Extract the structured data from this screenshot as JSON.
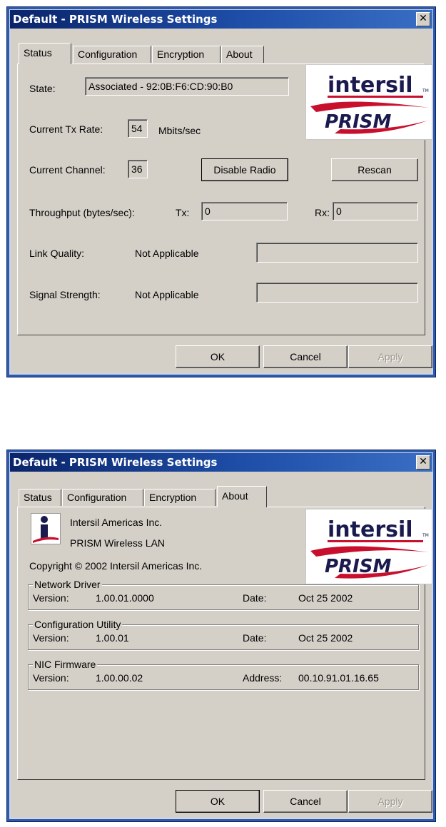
{
  "window_title": "Default - PRISM Wireless Settings",
  "close_glyph": "✕",
  "tabs": [
    "Status",
    "Configuration",
    "Encryption",
    "About"
  ],
  "buttons": {
    "ok": "OK",
    "cancel": "Cancel",
    "apply": "Apply"
  },
  "logo": {
    "intersil_text": "intersil",
    "tm": "TM",
    "prism_text": "PRISM",
    "brand_red": "#c8102e",
    "brand_navy": "#1a1a4e"
  },
  "status": {
    "state_label": "State:",
    "state_value": "Associated - 92:0B:F6:CD:90:B0",
    "tx_rate_label": "Current Tx Rate:",
    "tx_rate_value": "54",
    "tx_rate_unit": "Mbits/sec",
    "channel_label": "Current Channel:",
    "channel_value": "36",
    "disable_radio": "Disable Radio",
    "rescan": "Rescan",
    "throughput_label": "Throughput (bytes/sec):",
    "tx_label": "Tx:",
    "tx_value": "0",
    "rx_label": "Rx:",
    "rx_value": "0",
    "link_quality_label": "Link Quality:",
    "link_quality_value": "Not Applicable",
    "signal_strength_label": "Signal Strength:",
    "signal_strength_value": "Not Applicable"
  },
  "about": {
    "company": "Intersil Americas Inc.",
    "product": "PRISM Wireless LAN",
    "copyright": "Copyright © 2002  Intersil Americas Inc.",
    "network_driver": {
      "title": "Network Driver",
      "version_label": "Version:",
      "version": "1.00.01.0000",
      "date_label": "Date:",
      "date": "Oct 25 2002"
    },
    "config_utility": {
      "title": "Configuration Utility",
      "version_label": "Version:",
      "version": "1.00.01",
      "date_label": "Date:",
      "date": "Oct 25 2002"
    },
    "nic_firmware": {
      "title": "NIC Firmware",
      "version_label": "Version:",
      "version": "1.00.00.02",
      "address_label": "Address:",
      "address": "00.10.91.01.16.65"
    }
  }
}
